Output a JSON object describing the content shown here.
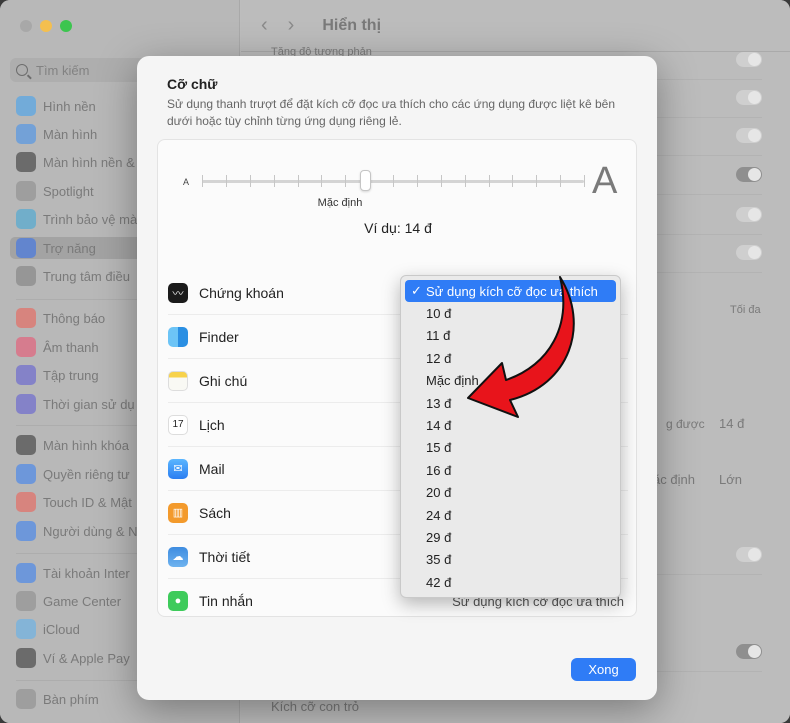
{
  "background": {
    "search_placeholder": "Tìm kiếm",
    "sidebar_items": [
      {
        "label": "Hình nền",
        "color": "#38a1f4"
      },
      {
        "label": "Màn hình",
        "color": "#3b8ef0"
      },
      {
        "label": "Màn hình nền &",
        "color": "#2c2c2c"
      },
      {
        "label": "Spotlight",
        "color": "#888888"
      },
      {
        "label": "Trình bảo vệ mà",
        "color": "#37a6d9"
      },
      {
        "label": "Trợ năng",
        "color": "#2d6ef2"
      },
      {
        "label": "Trung tâm điều",
        "color": "#7a7a7a"
      },
      {
        "label": "Thông báo",
        "color": "#f05a4f"
      },
      {
        "label": "Âm thanh",
        "color": "#ef4b6b"
      },
      {
        "label": "Tập trung",
        "color": "#5a55d6"
      },
      {
        "label": "Thời gian sử dụ",
        "color": "#5a55d6"
      },
      {
        "label": "Màn hình khóa",
        "color": "#2c2c2c"
      },
      {
        "label": "Quyền riêng tư",
        "color": "#2f7cf6"
      },
      {
        "label": "Touch ID & Mật",
        "color": "#f05a4f"
      },
      {
        "label": "Người dùng & N",
        "color": "#2f7cf6"
      },
      {
        "label": "Tài khoản Inter",
        "color": "#2f7cf6"
      },
      {
        "label": "Game Center",
        "color": "#888888"
      },
      {
        "label": "iCloud",
        "color": "#5ab0f0"
      },
      {
        "label": "Ví & Apple Pay",
        "color": "#2c2c2c"
      },
      {
        "label": "Bàn phím",
        "color": "#888888"
      }
    ],
    "main_title": "Hiển thị",
    "nav_back": "‹",
    "nav_forward": "›",
    "partial_top_text": "Tăng độ tương phản",
    "max_label": "Tối đa",
    "size_row_label": "g được",
    "size_row_value": "14 đ",
    "radio_default": "ặc định",
    "radio_large": "Lớn",
    "pointer_label": "Kích cỡ con trỏ"
  },
  "dialog": {
    "title": "Cỡ chữ",
    "description": "Sử dụng thanh trượt để đặt kích cỡ đọc ưa thích cho các ứng dụng được liệt kê bên dưới hoặc tùy chỉnh từng ứng dụng riêng lẻ.",
    "slider": {
      "small_label": "A",
      "large_label": "A",
      "default_label": "Mặc định",
      "position": 0.43
    },
    "example_text": "Ví dụ: 14 đ",
    "apps": [
      {
        "name": "Chứng khoán",
        "icon": "stocks-icon",
        "glyph": "〰"
      },
      {
        "name": "Finder",
        "icon": "finder-icon",
        "glyph": ""
      },
      {
        "name": "Ghi chú",
        "icon": "notes-icon",
        "glyph": ""
      },
      {
        "name": "Lịch",
        "icon": "calendar-icon",
        "glyph": "17"
      },
      {
        "name": "Mail",
        "icon": "mail-icon",
        "glyph": "✉"
      },
      {
        "name": "Sách",
        "icon": "books-icon",
        "glyph": "▥"
      },
      {
        "name": "Thời tiết",
        "icon": "weather-icon",
        "glyph": "☁"
      },
      {
        "name": "Tin nhắn",
        "icon": "messages-icon",
        "glyph": "●"
      }
    ],
    "last_row_select": "Sử dụng kích cỡ đọc ưa thích",
    "menu": {
      "selected": "Sử dụng kích cỡ đọc ưa thích",
      "check": "✓",
      "options": [
        "10 đ",
        "11 đ",
        "12 đ",
        "Mặc định",
        "13 đ",
        "14 đ",
        "15 đ",
        "16 đ",
        "20 đ",
        "24 đ",
        "29 đ",
        "35 đ",
        "42 đ"
      ]
    },
    "done_label": "Xong"
  },
  "colors": {
    "accent": "#2f7cf6",
    "arrow": "#e8141b"
  }
}
